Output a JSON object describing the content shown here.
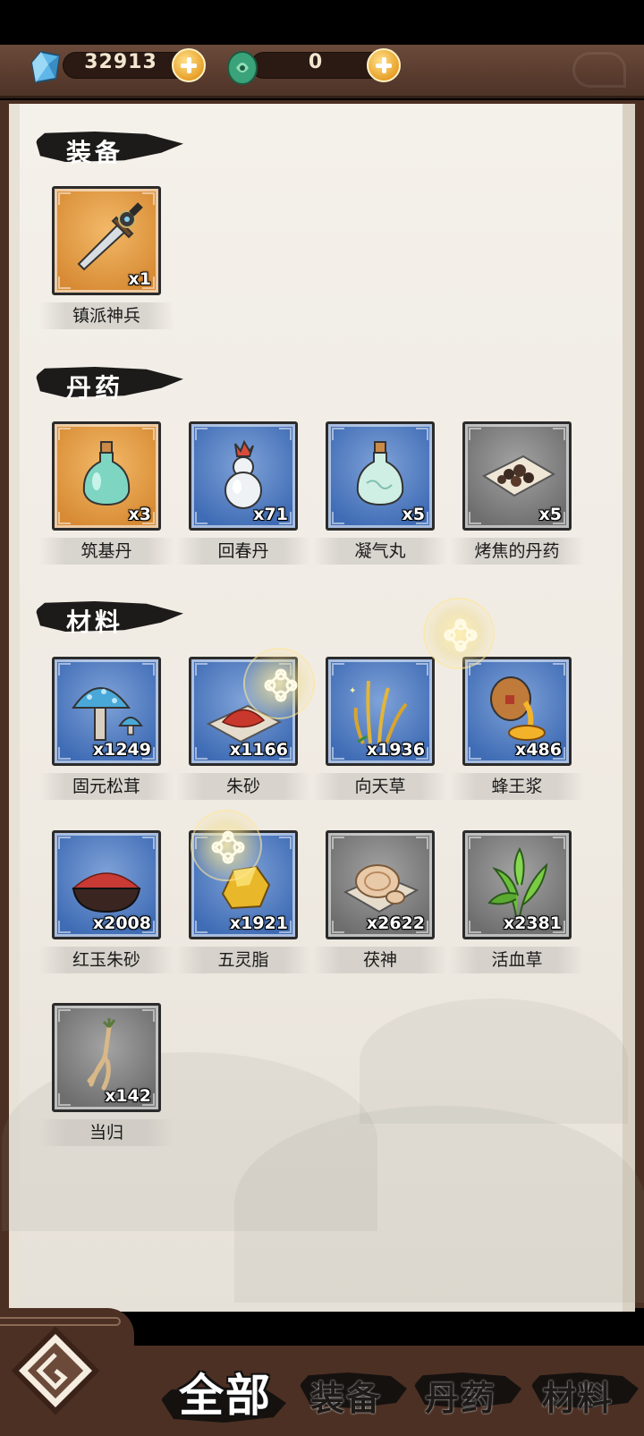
{
  "currency": {
    "spirit_stones": "32913",
    "jade": "0"
  },
  "sections": [
    {
      "title": "装备",
      "items": [
        {
          "name": "镇派神兵",
          "count": "x1",
          "rarity": "gold",
          "art": "sword"
        }
      ]
    },
    {
      "title": "丹药",
      "items": [
        {
          "name": "筑基丹",
          "count": "x3",
          "rarity": "gold",
          "art": "bottle-green"
        },
        {
          "name": "回春丹",
          "count": "x71",
          "rarity": "blue",
          "art": "gourd"
        },
        {
          "name": "凝气丸",
          "count": "x5",
          "rarity": "blue",
          "art": "bottle-pale"
        },
        {
          "name": "烤焦的丹药",
          "count": "x5",
          "rarity": "gray",
          "art": "burnt-pills"
        }
      ]
    },
    {
      "title": "材料",
      "items": [
        {
          "name": "固元松茸",
          "count": "x1249",
          "rarity": "blue",
          "art": "mushroom"
        },
        {
          "name": "朱砂",
          "count": "x1166",
          "rarity": "blue",
          "art": "cinnabar"
        },
        {
          "name": "向天草",
          "count": "x1936",
          "rarity": "blue",
          "art": "grass"
        },
        {
          "name": "蜂王浆",
          "count": "x486",
          "rarity": "blue",
          "art": "jelly"
        },
        {
          "name": "红玉朱砂",
          "count": "x2008",
          "rarity": "blue",
          "art": "red-bowl"
        },
        {
          "name": "五灵脂",
          "count": "x1921",
          "rarity": "blue",
          "art": "resin"
        },
        {
          "name": "茯神",
          "count": "x2622",
          "rarity": "gray",
          "art": "fungus"
        },
        {
          "name": "活血草",
          "count": "x2381",
          "rarity": "gray",
          "art": "herb"
        },
        {
          "name": "当归",
          "count": "x142",
          "rarity": "gray",
          "art": "root"
        }
      ]
    }
  ],
  "tabs": [
    {
      "label": "全部",
      "active": true
    },
    {
      "label": "装备",
      "active": false
    },
    {
      "label": "丹药",
      "active": false
    },
    {
      "label": "材料",
      "active": false
    }
  ],
  "colors": {
    "frame_brown": "#4c3024",
    "paper": "#f4f0ea",
    "rarity_gold": "#d88b34",
    "rarity_blue": "#3f6cb5",
    "rarity_gray": "#6e6e6e",
    "plus_button": "#e8a12a"
  },
  "icons": [
    "spirit-stone-icon",
    "jade-icon",
    "plus-icon",
    "home-emblem-icon",
    "lucky-knot-icon"
  ]
}
